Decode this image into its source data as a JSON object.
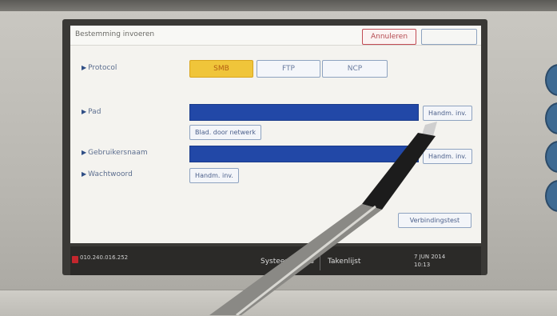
{
  "screen": {
    "title": "Bestemming invoeren",
    "cancel_label": "Annuleren",
    "ok_label": ""
  },
  "rows": {
    "protocol": {
      "label": "Protocol",
      "options": [
        "SMB",
        "FTP",
        "NCP"
      ],
      "selected": "SMB"
    },
    "path": {
      "label": "Pad",
      "manual_label": "Handm. inv.",
      "browse_label": "Blad. door netwerk"
    },
    "username": {
      "label": "Gebruikersnaam",
      "manual_label": "Handm. inv."
    },
    "password": {
      "label": "Wachtwoord",
      "manual_label": "Handm. inv."
    }
  },
  "actions": {
    "test_label": "Verbindingstest"
  },
  "status": {
    "ip": "010.240.016.252",
    "system_status": "Systeemstatus",
    "job_list": "Takenlijst",
    "date": "7 JUN 2014",
    "time": "10:13"
  },
  "colors": {
    "selected": "#f0c53a",
    "field": "#2248a7",
    "cancel": "#c24c55"
  }
}
